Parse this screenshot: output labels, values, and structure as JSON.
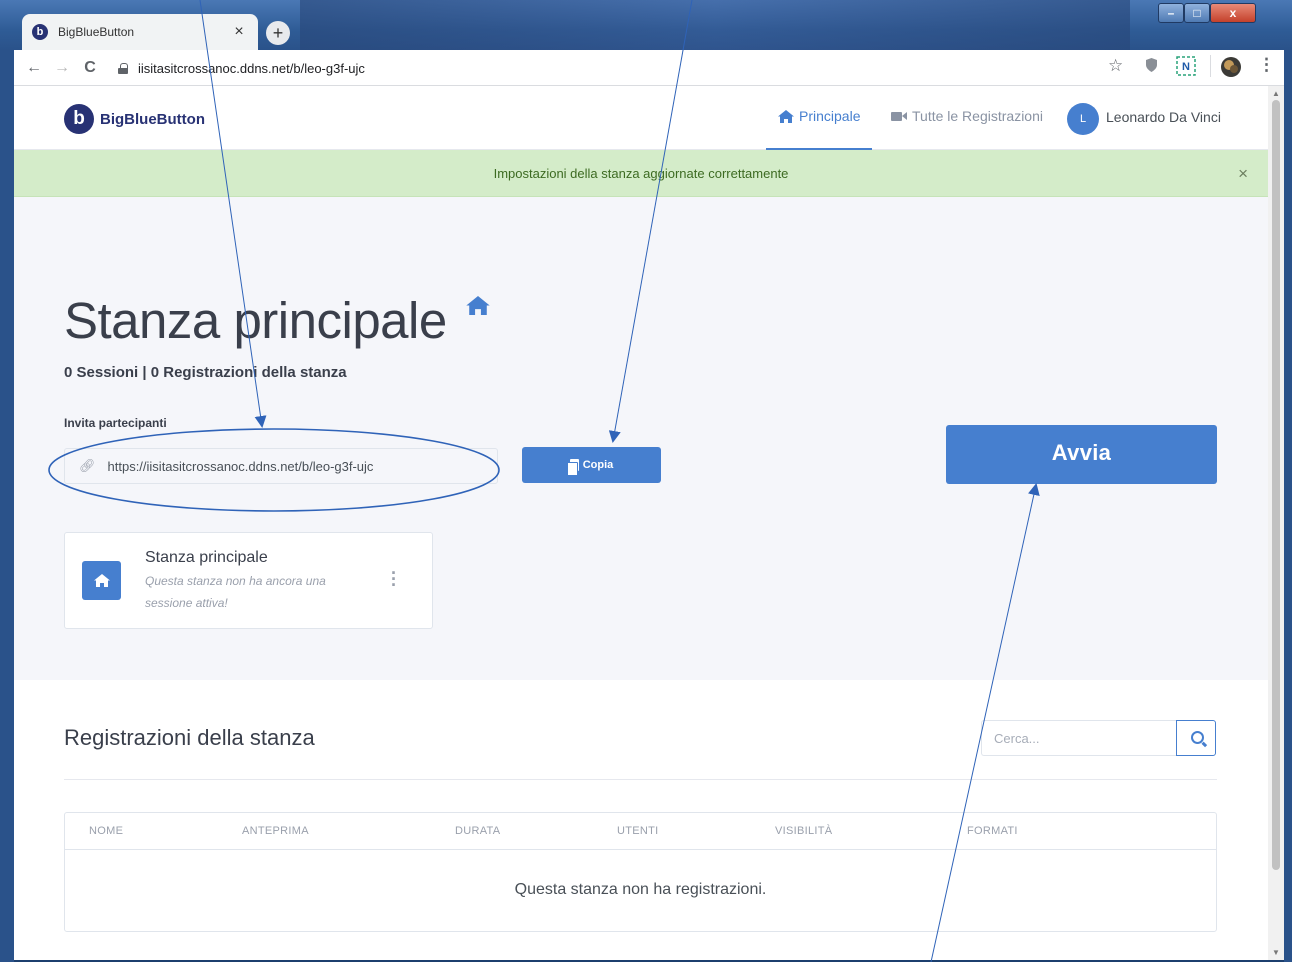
{
  "browser": {
    "tab_title": "BigBlueButton",
    "tab_close": "×",
    "new_tab": "+",
    "url": "iisitasitcrossanoc.ddns.net/b/leo-g3f-ujc",
    "back": "←",
    "forward": "→",
    "reload": "C",
    "star": "☆",
    "menu": "⋮",
    "win_min": "–",
    "win_max": "□",
    "win_close": "x"
  },
  "header": {
    "logo_letter": "b",
    "logo_text": "BigBlueButton",
    "nav_home": "Principale",
    "nav_recordings": "Tutte le Registrazioni",
    "avatar_initial": "L",
    "user_name": "Leonardo Da Vinci"
  },
  "alert": {
    "message": "Impostazioni della stanza aggiornate correttamente",
    "close": "×"
  },
  "room": {
    "title": "Stanza principale",
    "stats": "0 Sessioni | 0 Registrazioni della stanza",
    "invite_label": "Invita partecipanti",
    "invite_url": "https://iisitasitcrossanoc.ddns.net/b/leo-g3f-ujc",
    "copy_label": "Copia",
    "start_label": "Avvia"
  },
  "room_card": {
    "title": "Stanza principale",
    "subtitle": "Questa stanza non ha ancora una sessione attiva!",
    "menu": "⋮"
  },
  "recordings": {
    "title": "Registrazioni della stanza",
    "search_placeholder": "Cerca...",
    "columns": [
      "NOME",
      "ANTEPRIMA",
      "DURATA",
      "UTENTI",
      "VISIBILITÀ",
      "FORMATI"
    ],
    "empty_message": "Questa stanza non ha registrazioni."
  },
  "colors": {
    "primary": "#467fcf",
    "brand": "#283274",
    "alert_bg": "#d4ecc9",
    "annotation": "#2f63b8"
  },
  "icons": [
    "home-icon",
    "video-icon",
    "link-icon",
    "clipboard-icon",
    "search-icon",
    "kebab-menu-icon",
    "lock-icon"
  ]
}
